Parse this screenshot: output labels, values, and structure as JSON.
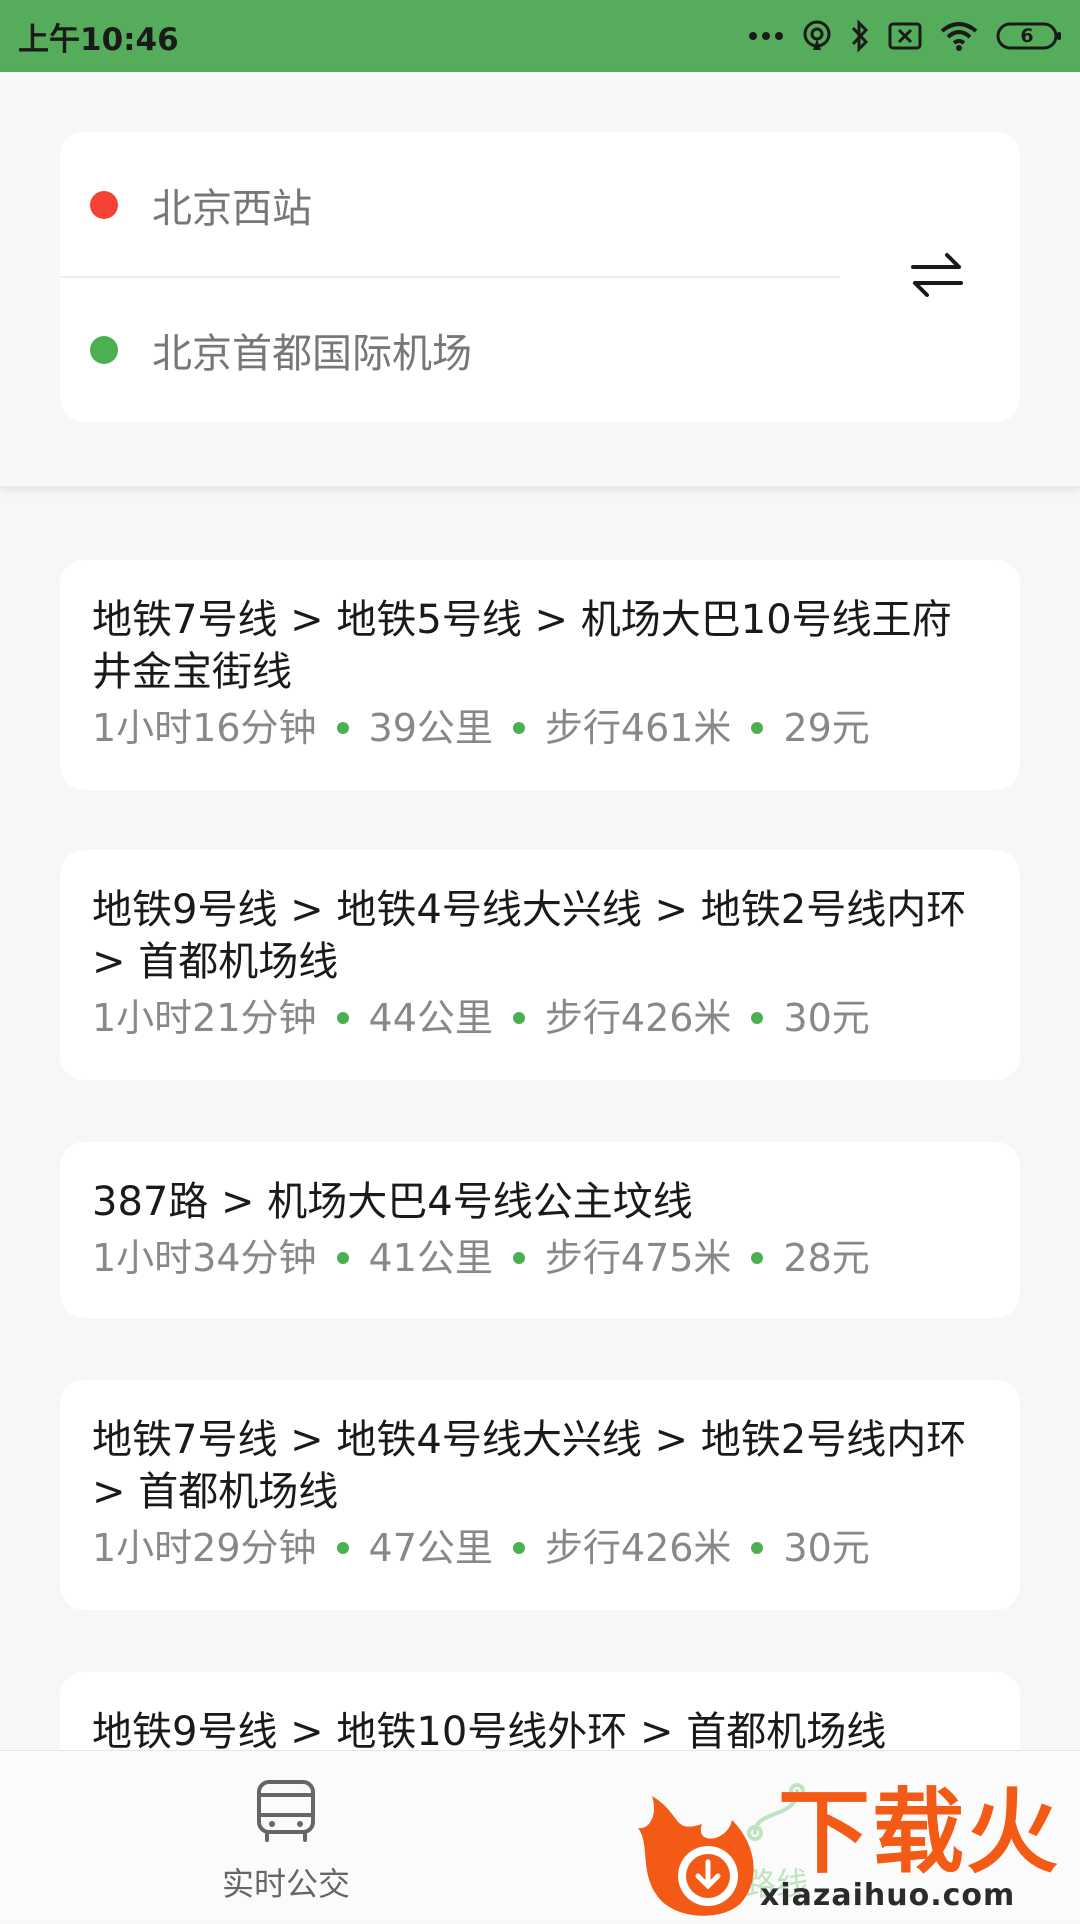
{
  "status_bar": {
    "time": "上午10:46",
    "battery": "6",
    "icons": [
      "more-dots-icon",
      "hotspot-icon",
      "bluetooth-icon",
      "sim-off-icon",
      "wifi-icon",
      "battery-icon"
    ]
  },
  "search": {
    "origin": "北京西站",
    "destination": "北京首都国际机场",
    "origin_dot_color": "#f44336",
    "destination_dot_color": "#4caf50",
    "swap_icon": "swap-arrows-icon"
  },
  "results": [
    {
      "title": "地铁7号线 > 地铁5号线 > 机场大巴10号线王府井金宝街线",
      "duration": "1小时16分钟",
      "distance": "39公里",
      "walk": "步行461米",
      "fare": "29元"
    },
    {
      "title": "地铁9号线 > 地铁4号线大兴线 > 地铁2号线内环 > 首都机场线",
      "duration": "1小时21分钟",
      "distance": "44公里",
      "walk": "步行426米",
      "fare": "30元"
    },
    {
      "title": "387路 > 机场大巴4号线公主坟线",
      "duration": "1小时34分钟",
      "distance": "41公里",
      "walk": "步行475米",
      "fare": "28元"
    },
    {
      "title": "地铁7号线 > 地铁4号线大兴线 > 地铁2号线内环 > 首都机场线",
      "duration": "1小时29分钟",
      "distance": "47公里",
      "walk": "步行426米",
      "fare": "30元"
    },
    {
      "title": "地铁9号线 > 地铁10号线外环 > 首都机场线"
    }
  ],
  "bottom_nav": {
    "items": [
      {
        "label": "实时公交",
        "icon": "bus-icon"
      },
      {
        "label": "路线",
        "icon": "route-icon"
      }
    ]
  },
  "watermark": {
    "text": "下载火",
    "url": "xiazaihuo.com"
  },
  "colors": {
    "status_bar": "#55ad5c",
    "accent_green": "#4caf50",
    "origin_red": "#f44336",
    "watermark_orange": "#f25a16"
  }
}
